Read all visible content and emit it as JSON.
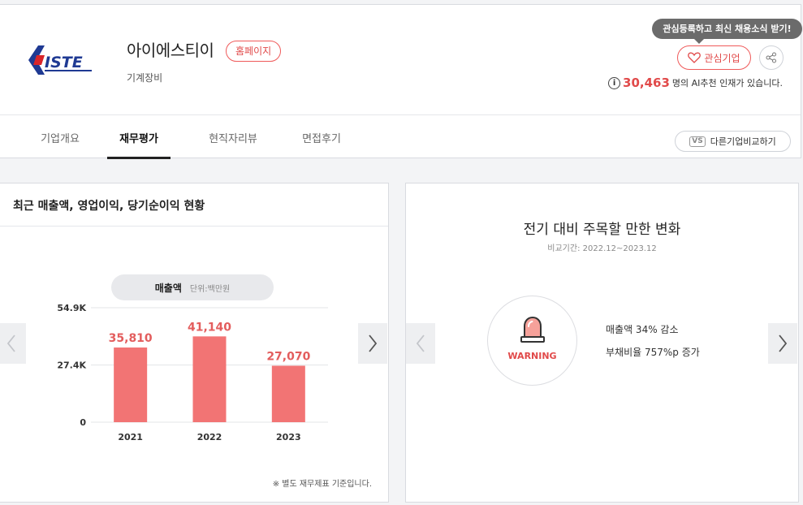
{
  "company": {
    "logo_text": "ISTE",
    "name": "아이에스티이",
    "homepage_label": "홈페이지",
    "industry": "기계장비"
  },
  "actions": {
    "tooltip": "관심등록하고 최신 채용소식 받기!",
    "favorite_label": "관심기업",
    "ai_count": "30,463",
    "ai_suffix": "명의 AI추천 인재가 있습니다.",
    "info_glyph": "i"
  },
  "tabs": [
    {
      "label": "기업개요",
      "active": false
    },
    {
      "label": "재무평가",
      "active": true
    },
    {
      "label": "현직자리뷰",
      "active": false
    },
    {
      "label": "면접후기",
      "active": false
    }
  ],
  "compare": {
    "vs": "VS",
    "label": "다른기업비교하기"
  },
  "finance_panel": {
    "title": "최근 매출액, 영업이익, 당기순이익 현황",
    "pill_label": "매출액",
    "pill_unit": "단위:백만원",
    "footnote": "※ 별도 재무제표 기준입니다."
  },
  "chart_data": {
    "type": "bar",
    "title": "",
    "categories": [
      "2021",
      "2022",
      "2023"
    ],
    "values": [
      35810,
      41140,
      27070
    ],
    "value_labels": [
      "35,810",
      "41,140",
      "27,070"
    ],
    "yticks": [
      0,
      27400,
      54900
    ],
    "ytick_labels": [
      "0",
      "27.4K",
      "54.9K"
    ],
    "ylim": [
      0,
      54900
    ],
    "grid": true,
    "bar_color": "#f27474",
    "label_color": "#e35d5d"
  },
  "change_panel": {
    "title": "전기 대비 주목할 만한 변화",
    "period": "비교기간: 2022.12~2023.12",
    "warning_label": "WARNING",
    "changes": [
      "매출액 34% 감소",
      "부채비율 757%p 증가"
    ]
  },
  "colors": {
    "accent": "#e14a4a",
    "logo_blue": "#1f3a93",
    "logo_red": "#d9252a"
  }
}
